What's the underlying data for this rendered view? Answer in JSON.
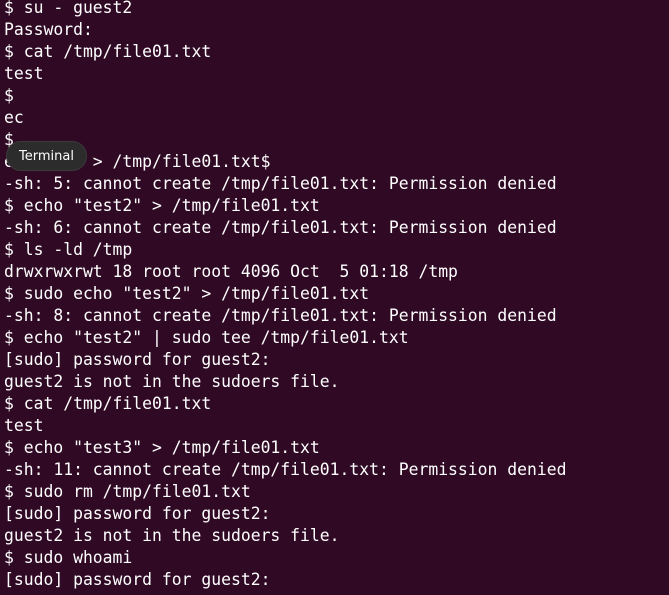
{
  "terminal": {
    "lines": [
      "$ su - guest2",
      "Password:",
      "$ cat /tmp/file01.txt",
      "test",
      "$",
      "ec",
      "$",
      "e   st2\" > /tmp/file01.txt$",
      "-sh: 5: cannot create /tmp/file01.txt: Permission denied",
      "$ echo \"test2\" > /tmp/file01.txt",
      "-sh: 6: cannot create /tmp/file01.txt: Permission denied",
      "$ ls -ld /tmp",
      "drwxrwxrwt 18 root root 4096 Oct  5 01:18 /tmp",
      "$ sudo echo \"test2\" > /tmp/file01.txt",
      "-sh: 8: cannot create /tmp/file01.txt: Permission denied",
      "$ echo \"test2\" | sudo tee /tmp/file01.txt",
      "[sudo] password for guest2:",
      "guest2 is not in the sudoers file.",
      "$ cat /tmp/file01.txt",
      "test",
      "$ echo \"test3\" > /tmp/file01.txt",
      "-sh: 11: cannot create /tmp/file01.txt: Permission denied",
      "$ sudo rm /tmp/file01.txt",
      "[sudo] password for guest2:",
      "guest2 is not in the sudoers file.",
      "$ sudo whoami",
      "[sudo] password for guest2:"
    ],
    "tooltip": "Terminal"
  },
  "colors": {
    "background": "#300a24",
    "foreground": "#ffffff",
    "tooltip_bg": "#2c2c2c"
  }
}
